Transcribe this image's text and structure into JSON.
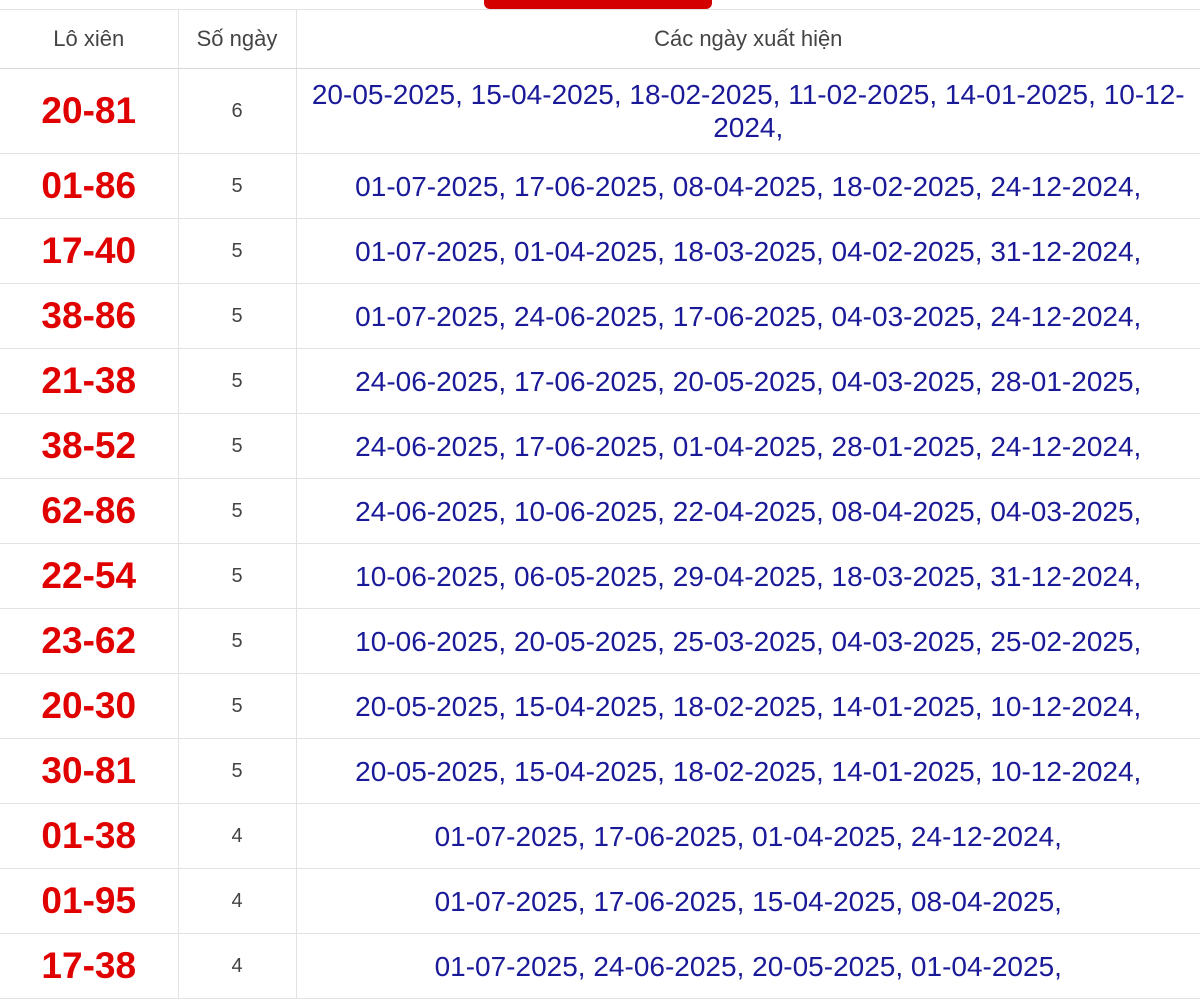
{
  "headers": {
    "pair": "Lô xiên",
    "days": "Số ngày",
    "dates": "Các ngày xuất hiện"
  },
  "rows": [
    {
      "pair": "20-81",
      "days": "6",
      "dates": "20-05-2025, 15-04-2025, 18-02-2025, 11-02-2025, 14-01-2025, 10-12-2024,"
    },
    {
      "pair": "01-86",
      "days": "5",
      "dates": "01-07-2025, 17-06-2025, 08-04-2025, 18-02-2025, 24-12-2024,"
    },
    {
      "pair": "17-40",
      "days": "5",
      "dates": "01-07-2025, 01-04-2025, 18-03-2025, 04-02-2025, 31-12-2024,"
    },
    {
      "pair": "38-86",
      "days": "5",
      "dates": "01-07-2025, 24-06-2025, 17-06-2025, 04-03-2025, 24-12-2024,"
    },
    {
      "pair": "21-38",
      "days": "5",
      "dates": "24-06-2025, 17-06-2025, 20-05-2025, 04-03-2025, 28-01-2025,"
    },
    {
      "pair": "38-52",
      "days": "5",
      "dates": "24-06-2025, 17-06-2025, 01-04-2025, 28-01-2025, 24-12-2024,"
    },
    {
      "pair": "62-86",
      "days": "5",
      "dates": "24-06-2025, 10-06-2025, 22-04-2025, 08-04-2025, 04-03-2025,"
    },
    {
      "pair": "22-54",
      "days": "5",
      "dates": "10-06-2025, 06-05-2025, 29-04-2025, 18-03-2025, 31-12-2024,"
    },
    {
      "pair": "23-62",
      "days": "5",
      "dates": "10-06-2025, 20-05-2025, 25-03-2025, 04-03-2025, 25-02-2025,"
    },
    {
      "pair": "20-30",
      "days": "5",
      "dates": "20-05-2025, 15-04-2025, 18-02-2025, 14-01-2025, 10-12-2024,"
    },
    {
      "pair": "30-81",
      "days": "5",
      "dates": "20-05-2025, 15-04-2025, 18-02-2025, 14-01-2025, 10-12-2024,"
    },
    {
      "pair": "01-38",
      "days": "4",
      "dates": "01-07-2025, 17-06-2025, 01-04-2025, 24-12-2024,"
    },
    {
      "pair": "01-95",
      "days": "4",
      "dates": "01-07-2025, 17-06-2025, 15-04-2025, 08-04-2025,"
    },
    {
      "pair": "17-38",
      "days": "4",
      "dates": "01-07-2025, 24-06-2025, 20-05-2025, 01-04-2025,"
    }
  ],
  "colors": {
    "pair_text": "#e00000",
    "dates_text": "#1a1a99",
    "header_text": "#444444",
    "top_tab": "#d40000"
  }
}
